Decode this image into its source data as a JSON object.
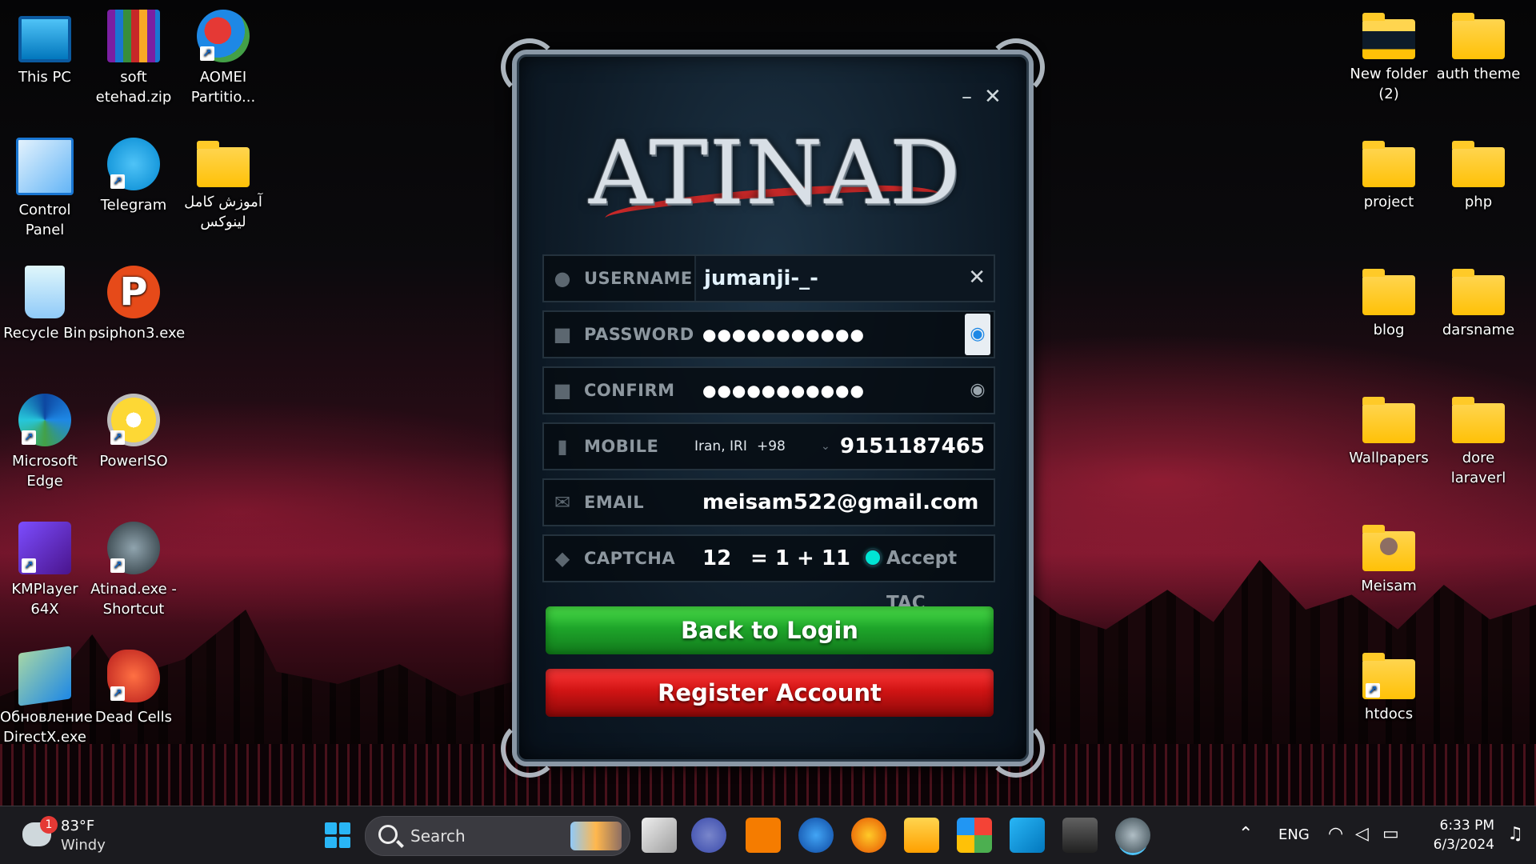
{
  "desktop": {
    "left_icons": [
      {
        "label": "This PC",
        "icon": "this-pc-icon"
      },
      {
        "label": "soft etehad.zip",
        "icon": "winrar-archive-icon"
      },
      {
        "label": "AOMEI Partitio...",
        "icon": "aomei-partition-icon"
      },
      {
        "label": "Control Panel",
        "icon": "control-panel-icon"
      },
      {
        "label": "Telegram",
        "icon": "telegram-icon"
      },
      {
        "label": "آموزش کامل لینوکس",
        "icon": "folder-icon"
      },
      {
        "label": "Recycle Bin",
        "icon": "recycle-bin-icon"
      },
      {
        "label": "psiphon3.exe",
        "icon": "psiphon-icon"
      },
      {
        "label": "Microsoft Edge",
        "icon": "edge-icon"
      },
      {
        "label": "PowerISO",
        "icon": "poweriso-icon"
      },
      {
        "label": "KMPlayer 64X",
        "icon": "kmplayer-icon"
      },
      {
        "label": "Atinad.exe - Shortcut",
        "icon": "atinad-icon"
      },
      {
        "label": "Обновление DirectX.exe",
        "icon": "directx-icon"
      },
      {
        "label": "Dead Cells",
        "icon": "dead-cells-icon"
      }
    ],
    "right_icons": [
      {
        "label": "New folder (2)",
        "icon": "folder-icon"
      },
      {
        "label": "auth theme",
        "icon": "folder-icon"
      },
      {
        "label": "project",
        "icon": "folder-icon"
      },
      {
        "label": "php",
        "icon": "folder-icon"
      },
      {
        "label": "blog",
        "icon": "folder-icon"
      },
      {
        "label": "darsname",
        "icon": "folder-icon"
      },
      {
        "label": "Wallpapers",
        "icon": "folder-icon"
      },
      {
        "label": "dore laraverl",
        "icon": "folder-icon"
      },
      {
        "label": "Meisam",
        "icon": "user-folder-icon"
      },
      {
        "label": "htdocs",
        "icon": "folder-shortcut-icon"
      }
    ]
  },
  "dialog": {
    "logo_text": "ATINAD",
    "minimize": "–",
    "close": "✕",
    "fields": {
      "username": {
        "label": "USERNAME",
        "value": "jumanji-_-",
        "clear": "✕"
      },
      "password": {
        "label": "PASSWORD",
        "value": "●●●●●●●●●●●"
      },
      "confirm": {
        "label": "CONFIRM",
        "value": "●●●●●●●●●●●"
      },
      "mobile": {
        "label": "MOBILE",
        "country": "Iran, IRI",
        "dial_code": "+98",
        "number": "9151187465"
      },
      "email": {
        "label": "EMAIL",
        "value": "meisam522@gmail.com"
      },
      "captcha": {
        "label": "CAPTCHA",
        "answer": "12",
        "question": "= 1 + 11",
        "accept": "Accept TAC"
      }
    },
    "buttons": {
      "back": "Back to Login",
      "register": "Register Account"
    }
  },
  "taskbar": {
    "weather": {
      "temp": "83°F",
      "condition": "Windy",
      "badge": "1"
    },
    "search_placeholder": "Search",
    "language": "ENG",
    "time": "6:33 PM",
    "date": "6/3/2024"
  }
}
